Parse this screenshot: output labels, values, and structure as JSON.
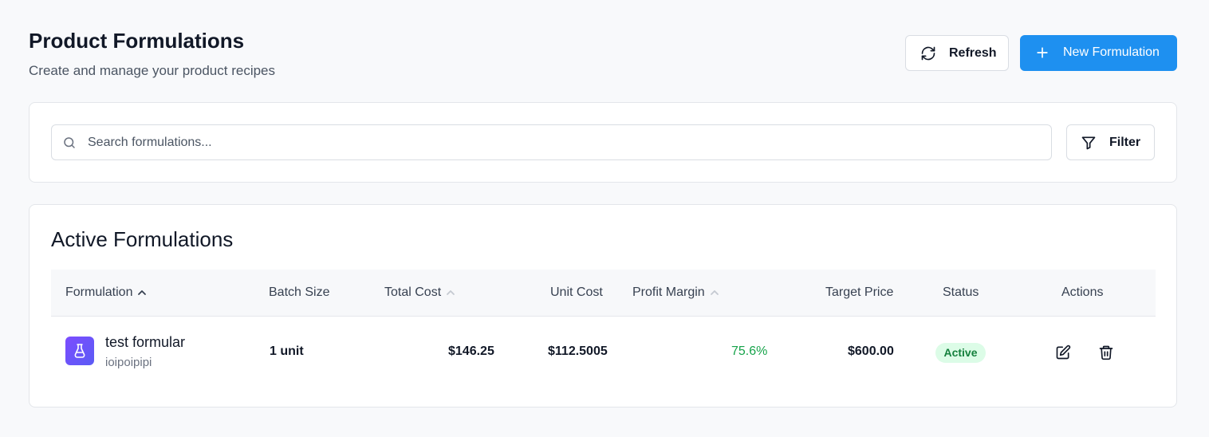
{
  "header": {
    "title": "Product Formulations",
    "subtitle": "Create and manage your product recipes",
    "refresh_label": "Refresh",
    "new_label": "New Formulation"
  },
  "search": {
    "placeholder": "Search formulations...",
    "value": "",
    "filter_label": "Filter"
  },
  "table": {
    "title": "Active Formulations",
    "columns": {
      "formulation": "Formulation",
      "batch_size": "Batch Size",
      "total_cost": "Total Cost",
      "unit_cost": "Unit Cost",
      "profit_margin": "Profit Margin",
      "target_price": "Target Price",
      "status": "Status",
      "actions": "Actions"
    },
    "rows": [
      {
        "name": "test formular",
        "description": "ioipoipipi",
        "batch_size": "1 unit",
        "total_cost": "$146.25",
        "unit_cost": "$112.5005",
        "profit_margin": "75.6%",
        "target_price": "$600.00",
        "status": "Active"
      }
    ]
  },
  "colors": {
    "primary": "#1e90f0",
    "status_active_bg": "#dcfce7",
    "status_active_text": "#15803d",
    "margin_text": "#16a34a",
    "avatar_gradient_start": "#7c4dff",
    "avatar_gradient_end": "#5b5bf5"
  },
  "icons": {
    "refresh": "refresh-icon",
    "new": "plus-icon",
    "search": "search-icon",
    "filter": "filter-icon",
    "sort": "chevron-up-icon",
    "formulation": "flask-icon",
    "edit": "edit-icon",
    "delete": "trash-icon"
  }
}
